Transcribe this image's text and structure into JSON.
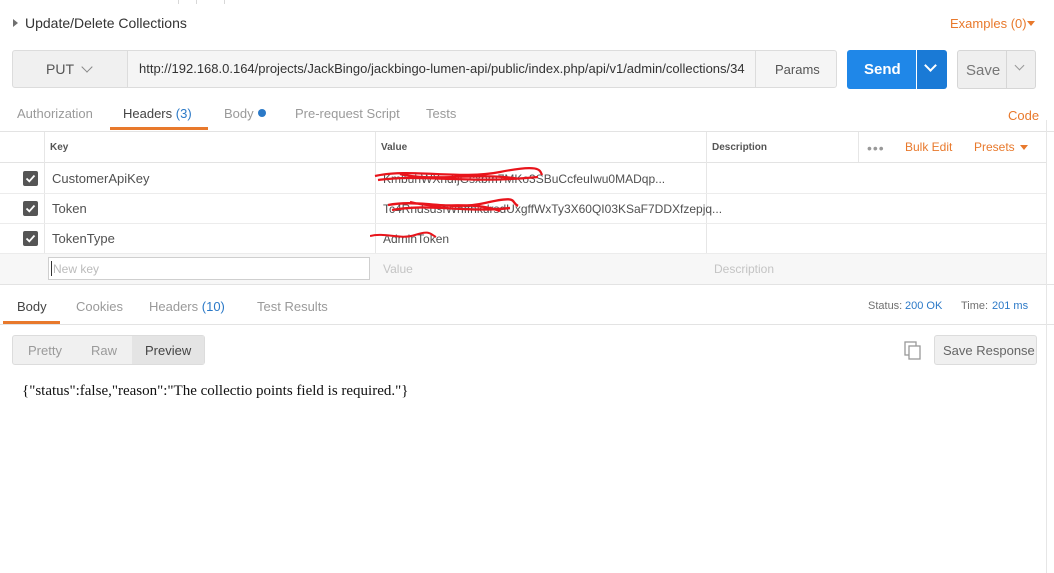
{
  "title": "Update/Delete Collections",
  "examples_label": "Examples (0)",
  "request": {
    "method": "PUT",
    "url": "http://192.168.0.164/projects/JackBingo/jackbingo-lumen-api/public/index.php/api/v1/admin/collections/34",
    "params_label": "Params",
    "send_label": "Send",
    "save_label": "Save"
  },
  "request_tabs": {
    "authorization": "Authorization",
    "headers": "Headers",
    "headers_count": "(3)",
    "body": "Body",
    "prerequest": "Pre-request Script",
    "tests": "Tests",
    "code": "Code"
  },
  "headers_table": {
    "columns": {
      "key": "Key",
      "value": "Value",
      "description": "Description"
    },
    "bulk_edit": "Bulk Edit",
    "presets": "Presets",
    "rows": [
      {
        "key": "CustomerApiKey",
        "value": "KmbuhWXndfjGsxbm7MKo3SBuCcfeuIwu0MADqp...",
        "checked": true
      },
      {
        "key": "Token",
        "value": "Tc4RndsdsfWhffnkdrsdUxgffWxTy3X60QI03KSaF7DDXfzepjq...",
        "checked": true
      },
      {
        "key": "TokenType",
        "value": "AdminToken",
        "checked": true
      }
    ],
    "new_key_placeholder": "New key",
    "new_value_placeholder": "Value",
    "new_description_placeholder": "Description"
  },
  "response_tabs": {
    "body": "Body",
    "cookies": "Cookies",
    "headers": "Headers",
    "headers_count": "(10)",
    "test_results": "Test Results"
  },
  "response_meta": {
    "status_label": "Status:",
    "status_value": "200 OK",
    "time_label": "Time:",
    "time_value": "201 ms"
  },
  "view_modes": {
    "pretty": "Pretty",
    "raw": "Raw",
    "preview": "Preview",
    "active": "Preview"
  },
  "save_response_label": "Save Response",
  "response_body": "{\"status\":false,\"reason\":\"The collectio points field is required.\"}",
  "colors": {
    "accent": "#e8792c",
    "send": "#1f87e8",
    "link": "#2b79c7",
    "redaction": "#e8141b"
  },
  "icons": [
    "caret-right-icon",
    "caret-down-icon",
    "chevron-down-icon",
    "checkbox-icon",
    "more-dots-icon",
    "copy-icon"
  ]
}
